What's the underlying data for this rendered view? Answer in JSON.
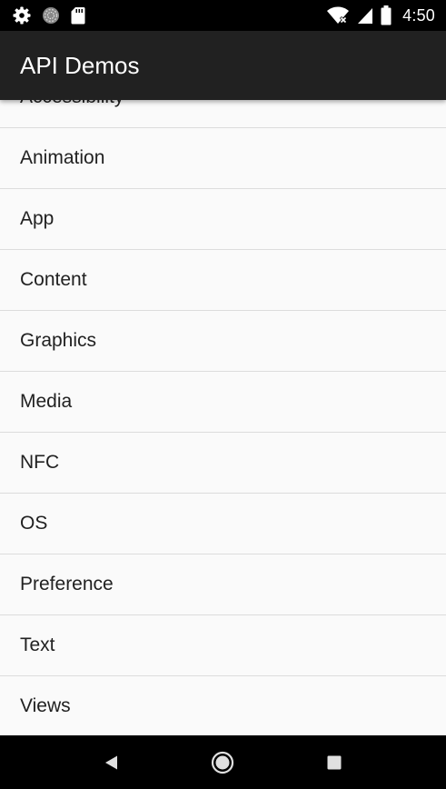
{
  "status_bar": {
    "time": "4:50",
    "left_icons": [
      "gear-icon",
      "sync-icon",
      "sd-card-icon"
    ],
    "right_icons": [
      "wifi-icon",
      "cellular-signal-icon",
      "battery-icon"
    ]
  },
  "app_bar": {
    "title": "API Demos"
  },
  "list": {
    "items": [
      {
        "label": "Accessibility"
      },
      {
        "label": "Animation"
      },
      {
        "label": "App"
      },
      {
        "label": "Content"
      },
      {
        "label": "Graphics"
      },
      {
        "label": "Media"
      },
      {
        "label": "NFC"
      },
      {
        "label": "OS"
      },
      {
        "label": "Preference"
      },
      {
        "label": "Text"
      },
      {
        "label": "Views"
      }
    ]
  },
  "nav_bar": {
    "buttons": [
      "back-icon",
      "home-icon",
      "recents-icon"
    ]
  }
}
